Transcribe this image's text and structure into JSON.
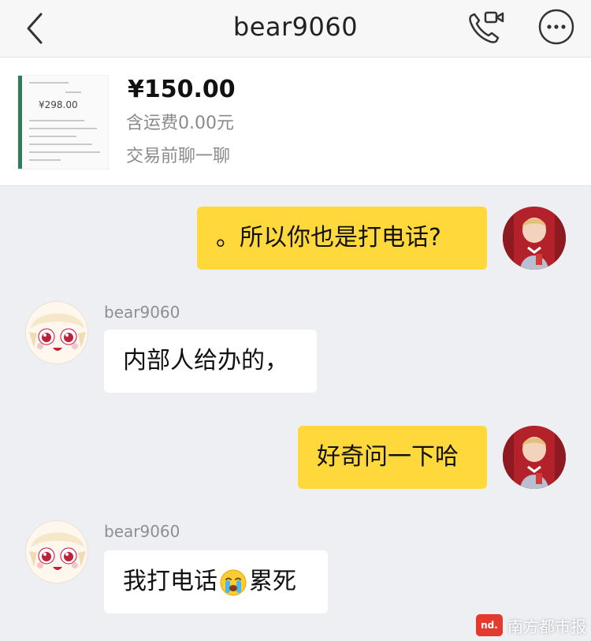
{
  "header": {
    "title": "bear9060",
    "back_icon": "chevron-left-icon",
    "call_icon": "phone-video-icon",
    "more_icon": "more-dots-icon"
  },
  "product": {
    "price": "¥150.00",
    "shipping": "含运费0.00元",
    "chat_hint": "交易前聊一聊",
    "thumb_price": "¥298.00"
  },
  "messages": [
    {
      "direction": "out",
      "text": "。所以你也是打电话?"
    },
    {
      "direction": "in",
      "sender": "bear9060",
      "text": "内部人给办的，"
    },
    {
      "direction": "out",
      "text": "好奇问一下哈"
    },
    {
      "direction": "in",
      "sender": "bear9060",
      "text_before": "我打电话",
      "emoji": "crying-face-icon",
      "text_after": "累死"
    }
  ],
  "watermark": {
    "logo": "nd.",
    "text": "南方都市报"
  },
  "colors": {
    "outgoing_bubble": "#ffd93b",
    "incoming_bubble": "#ffffff",
    "background": "#eeeff3"
  }
}
